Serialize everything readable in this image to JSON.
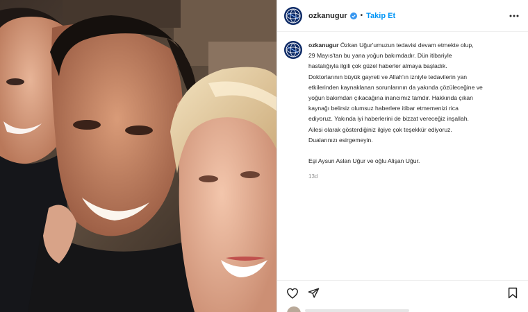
{
  "post": {
    "username": "ozkanugur",
    "follow_label": "Takip Et",
    "separator": "•",
    "time_ago": "13d"
  },
  "caption": {
    "author": "ozkanugur",
    "lines": [
      "Özkan Uğur'umuzun tedavisi devam etmekte olup,",
      "29 Mayıs'tan bu yana yoğun bakımdadır. Dün itibariyle",
      "hastalığıyla ilgili çok güzel haberler almaya başladık.",
      "Doktorlarının büyük gayreti ve Allah'ın izniyle tedavilerin yan",
      "etkilerinden kaynaklanan sorunlarının da yakında çözüleceğine ve",
      "yoğun bakımdan çıkacağına inancımız tamdır. Hakkında çıkan",
      "kaynağı belirsiz olumsuz haberlere itibar etmemenizi rica",
      "ediyoruz. Yakında iyi haberlerini de bizzat vereceğiz inşallah.",
      "Ailesi olarak gösterdiğiniz ilgiye çok teşekkür ediyoruz.",
      "Dualarınızı esirgemeyin.",
      "",
      "Eşi Aysun Aslan Uğur ve oğlu Alişan Uğur."
    ]
  },
  "icons": {
    "avatar": "globe-logo-icon",
    "verified": "verified-badge-icon",
    "more": "more-options-icon",
    "like": "heart-icon",
    "share": "send-icon",
    "save": "bookmark-icon"
  },
  "colors": {
    "follow": "#0095f6",
    "verified": "#3897f0",
    "text": "#262626",
    "muted": "#8e8e8e",
    "avatar_bg": "#0d2a66"
  }
}
